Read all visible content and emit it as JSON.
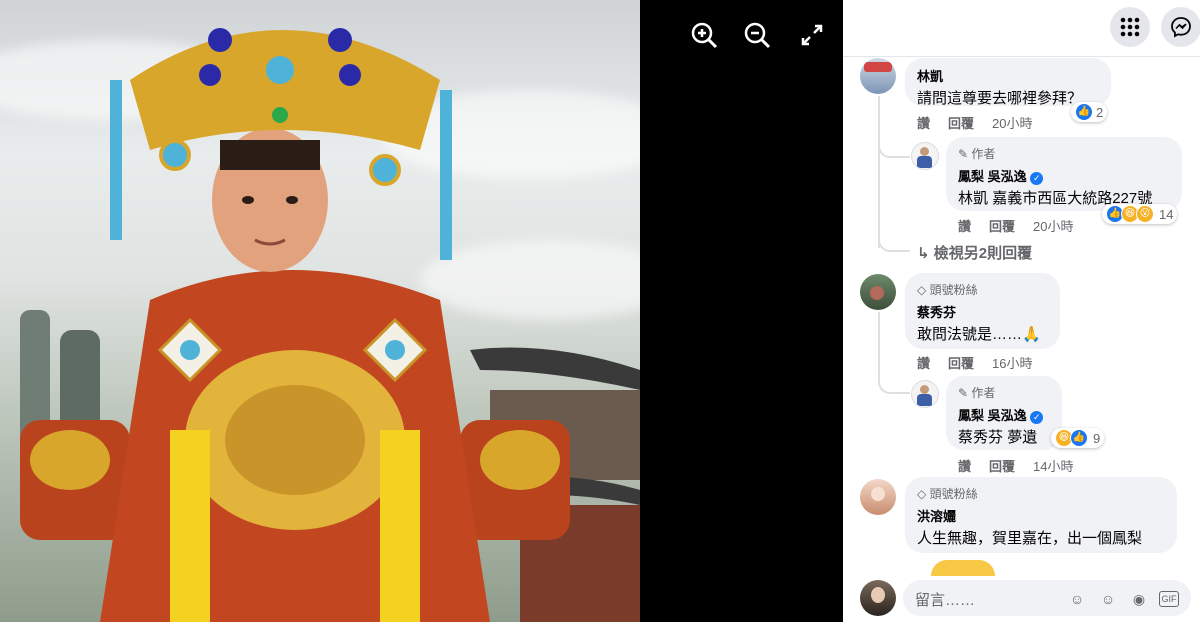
{
  "viewer": {
    "zoom_in_label": "放大",
    "zoom_out_label": "縮小",
    "fullscreen_label": "全螢幕"
  },
  "topbar": {
    "menu_icon": "grid-menu-icon",
    "messenger_icon": "messenger-icon"
  },
  "comments": [
    {
      "name": "林凱",
      "text": "請問這尊要去哪裡參拜？",
      "actions": [
        "讚",
        "回覆"
      ],
      "time": "20小時",
      "reactions": "2",
      "replies": [
        {
          "badge": "作者",
          "name": "鳳梨 吳泓逸",
          "mention": "林凱",
          "text": "嘉義市西區大統路227號",
          "actions": [
            "讚",
            "回覆"
          ],
          "time": "20小時",
          "reactions": "14"
        }
      ],
      "more_replies": "檢視另2則回覆"
    },
    {
      "badge": "頭號粉絲",
      "name": "蔡秀芬",
      "text": "敢問法號是……🙏",
      "actions": [
        "讚",
        "回覆"
      ],
      "time": "16小時",
      "replies": [
        {
          "badge": "作者",
          "name": "鳳梨 吳泓逸",
          "mention": "蔡秀芬",
          "text": "夢遺",
          "actions": [
            "讚",
            "回覆"
          ],
          "time": "14小時",
          "reactions": "9"
        }
      ]
    },
    {
      "badge": "頭號粉絲",
      "name": "洪溶孋",
      "text": "人生無趣，賀里嘉在，出一個鳳梨"
    }
  ],
  "composer": {
    "placeholder": "留言……"
  },
  "colors": {
    "like_blue": "#1877f2",
    "verified_blue": "#1877f2",
    "bubble_bg": "#f0f2f5"
  }
}
